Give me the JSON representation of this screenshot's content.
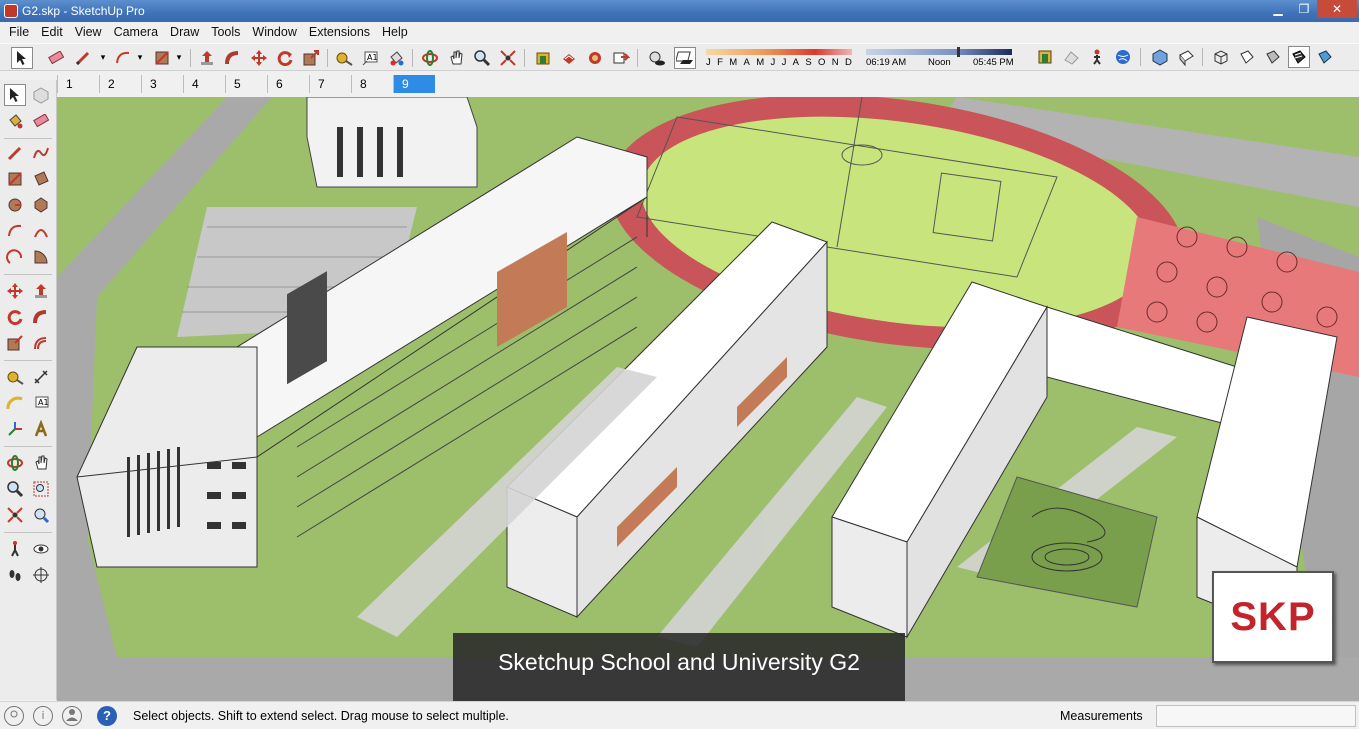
{
  "window": {
    "title": "G2.skp - SketchUp Pro",
    "minimize": "▁",
    "maximize": "❐",
    "close": "✕"
  },
  "menu": [
    "File",
    "Edit",
    "View",
    "Camera",
    "Draw",
    "Tools",
    "Window",
    "Extensions",
    "Help"
  ],
  "shadow_settings": {
    "months": [
      "J",
      "F",
      "M",
      "A",
      "M",
      "J",
      "J",
      "A",
      "S",
      "O",
      "N",
      "D"
    ],
    "sunrise": "06:19 AM",
    "noon": "Noon",
    "sunset": "05:45 PM",
    "time_position": 0.62
  },
  "scenes": {
    "tabs": [
      "1",
      "2",
      "3",
      "4",
      "5",
      "6",
      "7",
      "8",
      "9"
    ],
    "active": "9"
  },
  "viewport": {
    "caption": "Sketchup School and University G2",
    "badge": "SKP"
  },
  "statusbar": {
    "message": "Select objects. Shift to extend select. Drag mouse to select multiple.",
    "measurements_label": "Measurements",
    "measurements_value": "",
    "help_icon": "?",
    "info_icon": "i"
  },
  "colors": {
    "titlebar": "#3f72b8",
    "active_tab": "#2e8be6",
    "track": "#c9555a",
    "field": "#c7e57c",
    "grass": "#9bbd6a",
    "brand": "#c4232a"
  },
  "icons": {
    "toolbar": [
      "select-icon",
      "eraser-icon",
      "pencil-icon",
      "arc-icon",
      "rectangle-icon",
      "push-pull-icon",
      "follow-me-icon",
      "move-icon",
      "rotate-icon",
      "scale-icon",
      "tape-measure-icon",
      "text-icon",
      "paint-bucket-icon",
      "orbit-icon",
      "pan-icon",
      "zoom-icon",
      "zoom-extents-icon"
    ],
    "left": [
      "select-icon",
      "make-component-icon",
      "paint-bucket-icon",
      "eraser-icon"
    ]
  }
}
